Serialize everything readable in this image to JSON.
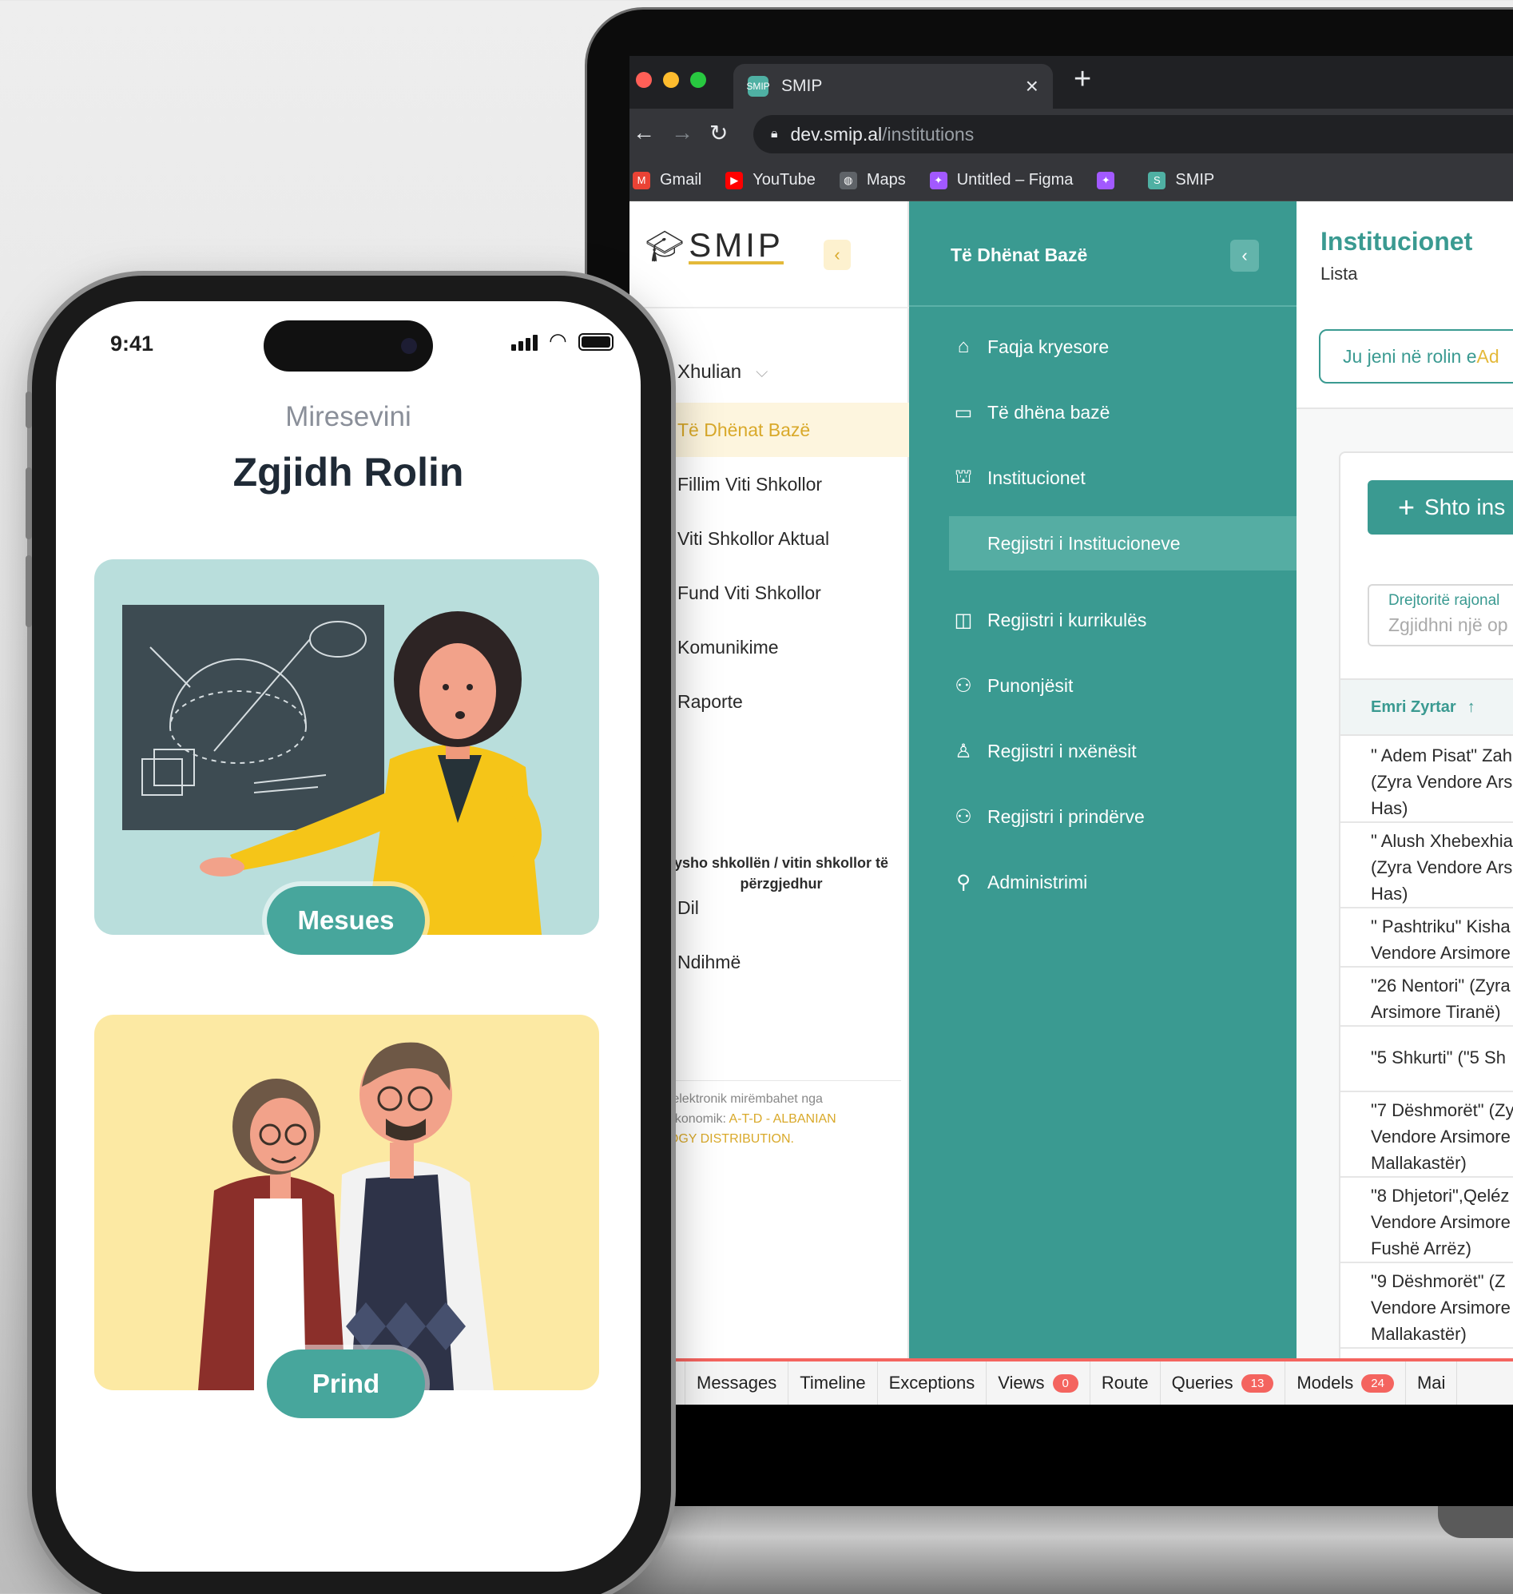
{
  "browser": {
    "tab_title": "SMIP",
    "tab_favicon_text": "SMIP",
    "tab_close": "×",
    "new_tab": "+",
    "url_host": "dev.smip.al",
    "url_path": "/institutions",
    "nav_back": "←",
    "nav_forward": "→",
    "nav_reload": "↻",
    "bookmarks": [
      {
        "label": "Gmail",
        "icon": "gmail-icon",
        "color": "#ea4335",
        "glyph": "M"
      },
      {
        "label": "YouTube",
        "icon": "youtube-icon",
        "color": "#ff0000",
        "glyph": "▶"
      },
      {
        "label": "Maps",
        "icon": "globe-icon",
        "color": "#5f6368",
        "glyph": "◍"
      },
      {
        "label": "Untitled – Figma",
        "icon": "figma-icon",
        "color": "#a259ff",
        "glyph": "✦"
      },
      {
        "label": "",
        "icon": "figma-icon",
        "color": "#a259ff",
        "glyph": "✦"
      },
      {
        "label": "SMIP",
        "icon": "smip-favicon",
        "color": "#4fb0a3",
        "glyph": "S"
      }
    ]
  },
  "app": {
    "logo_text": "SMIP",
    "collapse_glyph": "‹",
    "user_name": "Xhulian",
    "left_nav": [
      {
        "label": "Të Dhënat Bazë",
        "active": true
      },
      {
        "label": "Fillim Viti Shkollor",
        "active": false
      },
      {
        "label": "Viti Shkollor Aktual",
        "active": false
      },
      {
        "label": "Fund Viti Shkollor",
        "active": false
      },
      {
        "label": "Komunikime",
        "active": false
      },
      {
        "label": "Raporte",
        "active": false
      }
    ],
    "school_note": "ysho shkollën / vitin shkollor të përzgjedhur",
    "left_nav_bottom": [
      "Dil",
      "Ndihmë"
    ],
    "footer_line1": "n elektronik mirëmbahet nga",
    "footer_line2": "i ekonomik: ",
    "footer_company1": "A-T-D - ALBANIAN",
    "footer_company2": "LOGY DISTRIBUTION.",
    "teal_title": "Të Dhënat Bazë",
    "teal_nav": [
      {
        "label": "Faqja kryesore",
        "icon": "home-icon",
        "glyph": "⌂"
      },
      {
        "label": "Të dhëna bazë",
        "icon": "calendar-icon",
        "glyph": "▭"
      },
      {
        "label": "Institucionet",
        "icon": "bank-icon",
        "glyph": "⛫"
      },
      {
        "label": "Regjistri i kurrikulës",
        "icon": "book-icon",
        "glyph": "◫"
      },
      {
        "label": "Punonjësit",
        "icon": "team-icon",
        "glyph": "⚇"
      },
      {
        "label": "Regjistri i nxënësit",
        "icon": "user-icon",
        "glyph": "♙"
      },
      {
        "label": "Regjistri i prindërve",
        "icon": "users-icon",
        "glyph": "⚇"
      },
      {
        "label": "Administrimi",
        "icon": "admin-icon",
        "glyph": "⚲"
      }
    ],
    "teal_sub_item": "Regjistri i Institucioneve",
    "page_title": "Institucionet",
    "page_sub": "Lista",
    "role_banner_prefix": "Ju jeni në rolin e ",
    "role_banner_role": "Ad",
    "add_button": "Shto ins",
    "filter_label": "Drejtoritë rajonal",
    "filter_placeholder": "Zgjidhni një op",
    "table_header": "Emri Zyrtar",
    "table_sort_glyph": "↑",
    "rows": [
      "\" Adem Pisat\" Zah\n(Zyra Vendore Ars\nHas)",
      "\" Alush Xhebexhia\n(Zyra Vendore Ars\nHas)",
      "\" Pashtriku\" Kisha\nVendore Arsimore",
      "\"26 Nentori\" (Zyra\nArsimore Tiranë)",
      "\"5 Shkurti\" (\"5 Sh",
      "\"7 Dëshmorët\" (Zy\nVendore Arsimore\nMallakastër)",
      "\"8 Dhjetori\",Qeléz\nVendore Arsimore\nFushë Arrëz)",
      "\"9 Dëshmorët\" (Z\nVendore Arsimore\nMallakastër)"
    ]
  },
  "debugbar": {
    "items": [
      {
        "label": "Messages",
        "badge": ""
      },
      {
        "label": "Timeline",
        "badge": ""
      },
      {
        "label": "Exceptions",
        "badge": ""
      },
      {
        "label": "Views",
        "badge": "0"
      },
      {
        "label": "Route",
        "badge": ""
      },
      {
        "label": "Queries",
        "badge": "13"
      },
      {
        "label": "Models",
        "badge": "24"
      },
      {
        "label": "Mai",
        "badge": ""
      }
    ]
  },
  "phone": {
    "time": "9:41",
    "welcome": "Miresevini",
    "title": "Zgjidh Rolin",
    "role_teacher": "Mesues",
    "role_parent": "Prind"
  },
  "colors": {
    "teal": "#3a9a91",
    "gold": "#e4b93a",
    "debug_red": "#f4645f"
  }
}
